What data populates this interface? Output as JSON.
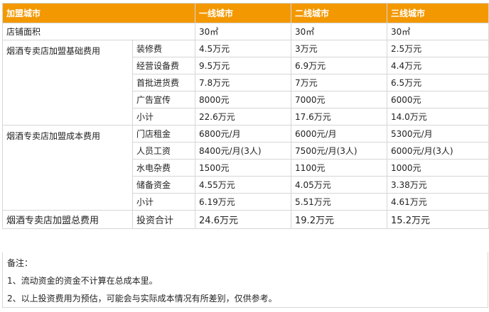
{
  "header": {
    "col0": "加盟城市",
    "col1": "一线城市",
    "col2": "二线城市",
    "col3": "三线城市"
  },
  "area": {
    "label": "店铺面积",
    "v1": "30㎡",
    "v2": "30㎡",
    "v3": "30㎡"
  },
  "basic": {
    "group": "烟酒专卖店加盟基础费用",
    "rows": [
      {
        "item": "装修费",
        "v1": "4.5万元",
        "v2": "3万元",
        "v3": "2.5万元"
      },
      {
        "item": "经营设备费",
        "v1": "9.5万元",
        "v2": "6.9万元",
        "v3": "4.4万元"
      },
      {
        "item": "首批进货费",
        "v1": "7.8万元",
        "v2": "7万元",
        "v3": "6.5万元"
      },
      {
        "item": "广告宣传",
        "v1": "8000元",
        "v2": "7000元",
        "v3": "6000元"
      },
      {
        "item": "小计",
        "v1": "22.6万元",
        "v2": "17.6万元",
        "v3": "14.0万元"
      }
    ]
  },
  "cost": {
    "group": "烟酒专卖店加盟成本费用",
    "rows": [
      {
        "item": "门店租金",
        "v1": "6800元/月",
        "v2": "6000元/月",
        "v3": "5300元/月"
      },
      {
        "item": "人员工资",
        "v1": "8400元/月(3人)",
        "v2": "7500元/月(3人)",
        "v3": "6000元/月(3人)"
      },
      {
        "item": "水电杂费",
        "v1": "1500元",
        "v2": "1100元",
        "v3": "1000元"
      },
      {
        "item": "储备资金",
        "v1": "4.55万元",
        "v2": "4.05万元",
        "v3": "3.38万元"
      },
      {
        "item": "小计",
        "v1": "6.19万元",
        "v2": "5.51万元",
        "v3": "4.61万元"
      }
    ]
  },
  "total": {
    "group": "烟酒专卖店加盟总费用",
    "item": "投资合计",
    "v1": "24.6万元",
    "v2": "19.2万元",
    "v3": "15.2万元"
  },
  "notes": {
    "title": "备注：",
    "lines": [
      "1、流动资金的资金不计算在总成本里。",
      "2、以上投资费用为预估，可能会与实际成本情况有所差别，仅供参考。"
    ]
  },
  "colors": {
    "header_bg": "#f39800",
    "border": "#d6d6d6"
  }
}
